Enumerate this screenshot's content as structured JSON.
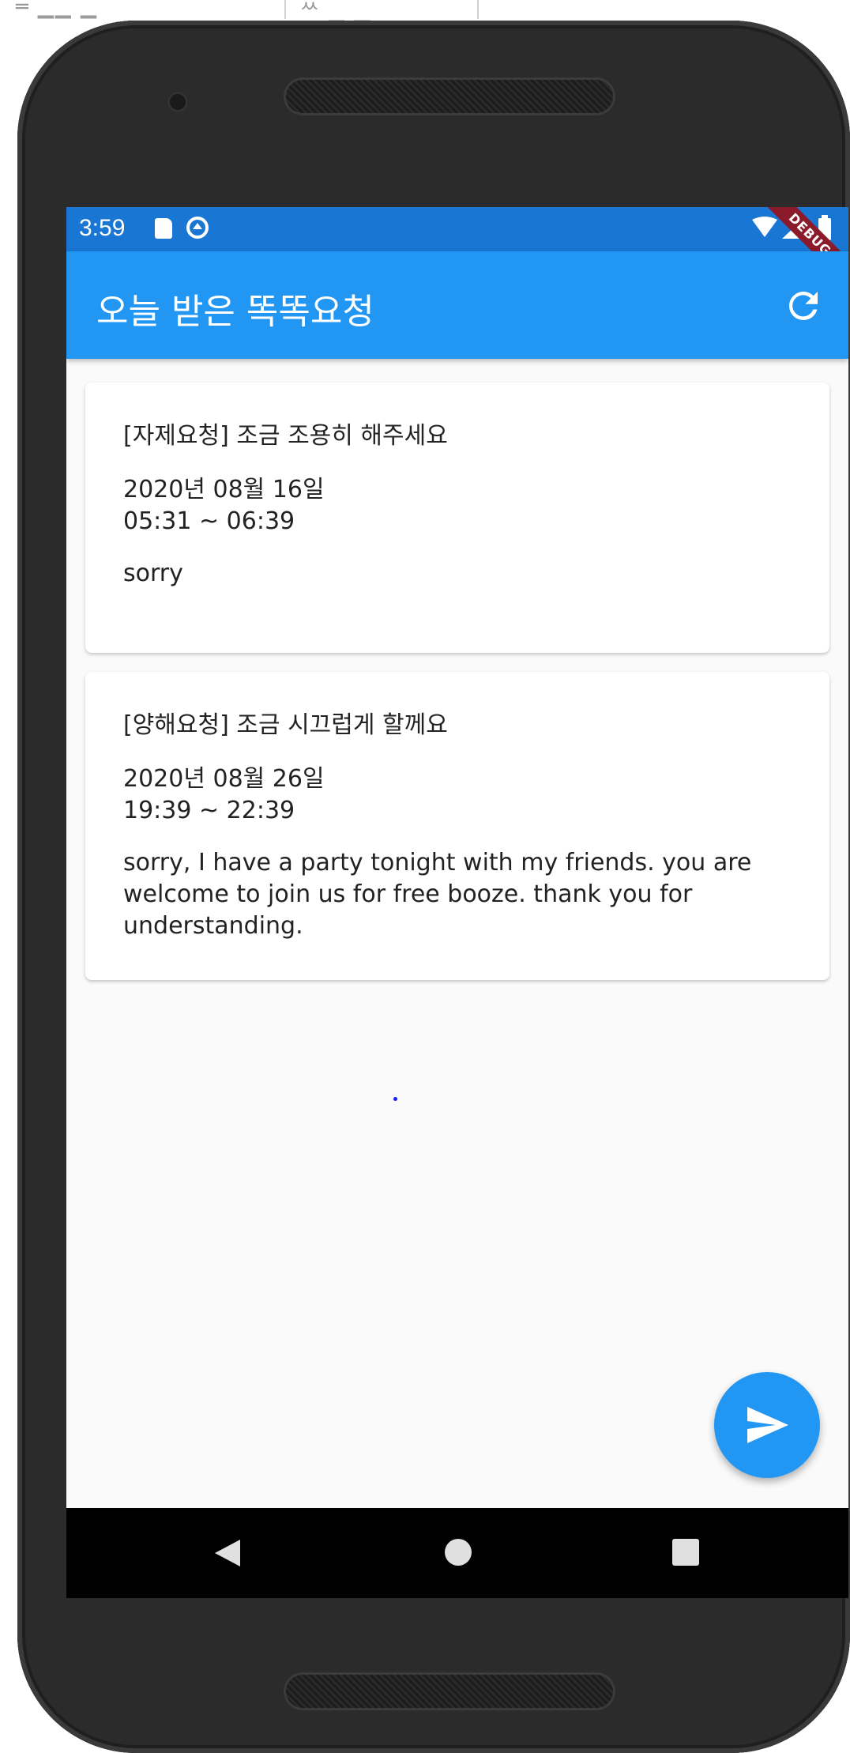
{
  "status_bar": {
    "time": "3:59",
    "icons": [
      "sd-card-icon",
      "sync-icon",
      "wifi-icon",
      "signal-icon",
      "battery-icon"
    ],
    "debug_label": "DEBUG"
  },
  "app_bar": {
    "title": "오늘 받은 똑똑요청",
    "refresh_icon": "refresh-icon"
  },
  "requests": [
    {
      "title": "[자제요청] 조금 조용히 해주세요",
      "date": "2020년 08월 16일",
      "time": "05:31 ~ 06:39",
      "message": "sorry"
    },
    {
      "title": "[양해요청] 조금 시끄럽게 할께요",
      "date": "2020년 08월 26일",
      "time": "19:39 ~ 22:39",
      "message": "sorry, I have a party tonight with my friends. you are welcome to join us for free booze. thank you for understanding."
    }
  ],
  "fab": {
    "icon": "send-icon"
  },
  "nav_bar": {
    "icons": [
      "back-icon",
      "home-icon",
      "recents-icon"
    ]
  },
  "colors": {
    "status_bar": "#1976d2",
    "app_bar": "#2196f3",
    "background": "#fafafa",
    "debug_ribbon": "#8b1a2b"
  }
}
